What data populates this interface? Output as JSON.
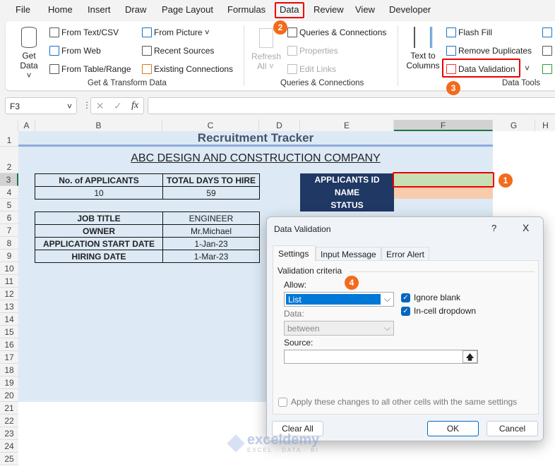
{
  "menu": [
    "File",
    "Home",
    "Insert",
    "Draw",
    "Page Layout",
    "Formulas",
    "Data",
    "Review",
    "View",
    "Developer"
  ],
  "ribbon": {
    "get_data": "Get",
    "get_data2": "Data",
    "from_text": "From Text/CSV",
    "from_web": "From Web",
    "from_table": "From Table/Range",
    "from_picture": "From Picture",
    "recent_sources": "Recent Sources",
    "existing_connections": "Existing Connections",
    "group1": "Get & Transform Data",
    "refresh": "Refresh",
    "refresh2": "All",
    "queries": "Queries & Connections",
    "properties": "Properties",
    "edit_links": "Edit Links",
    "group2": "Queries & Connections",
    "text_to": "Text to",
    "columns": "Columns",
    "flash_fill": "Flash Fill",
    "remove_duplicates": "Remove Duplicates",
    "data_validation": "Data Validation",
    "group3": "Data Tools"
  },
  "badges": [
    "1",
    "2",
    "3",
    "4"
  ],
  "formula_bar": {
    "name_box": "F3",
    "fx": "fx",
    "value": ""
  },
  "columns": [
    "A",
    "B",
    "C",
    "D",
    "E",
    "F",
    "G",
    "H"
  ],
  "rows": [
    "1",
    "2",
    "3",
    "4",
    "5",
    "6",
    "7",
    "8",
    "9",
    "10",
    "11",
    "12",
    "13",
    "14",
    "15",
    "16",
    "17",
    "18",
    "19",
    "20",
    "21",
    "22",
    "23",
    "24",
    "25"
  ],
  "sheet": {
    "title": "Recruitment Tracker",
    "company": "ABC DESIGN AND CONSTRUCTION COMPANY",
    "t1_headers": [
      "No. of APPLICANTS",
      "TOTAL DAYS TO HIRE"
    ],
    "t1_values": [
      "10",
      "59"
    ],
    "t2": [
      [
        "JOB TITLE",
        "ENGINEER"
      ],
      [
        "OWNER",
        "Mr.Michael"
      ],
      [
        "APPLICATION START DATE",
        "1-Jan-23"
      ],
      [
        "HIRING DATE",
        "1-Mar-23"
      ]
    ],
    "labels": [
      "APPLICANTS ID",
      "NAME",
      "STATUS"
    ]
  },
  "dialog": {
    "title": "Data Validation",
    "help": "?",
    "close": "X",
    "tabs": [
      "Settings",
      "Input Message",
      "Error Alert"
    ],
    "criteria": "Validation criteria",
    "allow_label": "Allow:",
    "allow_value": "List",
    "ignore_blank": "Ignore blank",
    "in_cell": "In-cell dropdown",
    "ignore_blank_checked": true,
    "in_cell_checked": true,
    "data_label": "Data:",
    "data_value": "between",
    "source_label": "Source:",
    "source_value": "",
    "apply_all": "Apply these changes to all other cells with the same settings",
    "apply_all_checked": false,
    "clear_all": "Clear All",
    "ok": "OK",
    "cancel": "Cancel"
  },
  "watermark": {
    "name": "exceldemy",
    "tag": "EXCEL · DATA · BI"
  },
  "colors": {
    "accent_red": "#e00000",
    "badge": "#f26b1d",
    "header_dark": "#1f3864",
    "sheet_fill": "#ddeaf5",
    "green_cell": "#c6e0b4",
    "orange_cell": "#f8cbad"
  }
}
